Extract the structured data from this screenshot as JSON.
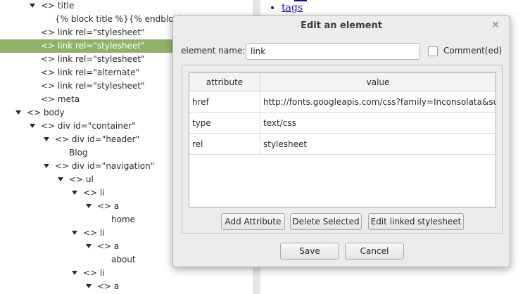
{
  "tree": {
    "rows": [
      {
        "text": "<> title",
        "arrow": true,
        "selected": false
      },
      {
        "text": "{% block title %}{% endblock %",
        "arrow": false,
        "selected": false
      },
      {
        "text": "<> link rel=\"stylesheet\"",
        "arrow": false,
        "selected": false
      },
      {
        "text": "<> link rel=\"stylesheet\"",
        "arrow": false,
        "selected": true
      },
      {
        "text": "<> link rel=\"stylesheet\"",
        "arrow": false,
        "selected": false
      },
      {
        "text": "<> link rel=\"alternate\"",
        "arrow": false,
        "selected": false
      },
      {
        "text": "<> link rel=\"stylesheet\"",
        "arrow": false,
        "selected": false
      },
      {
        "text": "<> meta",
        "arrow": false,
        "selected": false
      },
      {
        "text": "<> body",
        "arrow": true,
        "selected": false
      },
      {
        "text": "<> div id=\"container\"",
        "arrow": true,
        "selected": false
      },
      {
        "text": "<> div id=\"header\"",
        "arrow": true,
        "selected": false
      },
      {
        "text": "Blog",
        "arrow": false,
        "selected": false
      },
      {
        "text": "<> div id=\"navigation\"",
        "arrow": true,
        "selected": false
      },
      {
        "text": "<> ul",
        "arrow": true,
        "selected": false
      },
      {
        "text": "<> li",
        "arrow": true,
        "selected": false
      },
      {
        "text": "<> a",
        "arrow": true,
        "selected": false
      },
      {
        "text": "home",
        "arrow": false,
        "selected": false
      },
      {
        "text": "<> li",
        "arrow": true,
        "selected": false
      },
      {
        "text": "<> a",
        "arrow": true,
        "selected": false
      },
      {
        "text": "about",
        "arrow": false,
        "selected": false
      },
      {
        "text": "<> li",
        "arrow": true,
        "selected": false
      },
      {
        "text": "<> a",
        "arrow": true,
        "selected": false
      }
    ]
  },
  "preview": {
    "link_text": "tags",
    "link_color": "#1a0dab"
  },
  "dialog": {
    "title": "Edit an element",
    "close_icon": "close-icon",
    "element_name_label": "element name:",
    "element_name_value": "link",
    "comment_label": "Comment(ed)",
    "comment_checked": false,
    "table": {
      "headers": {
        "attribute": "attribute",
        "value": "value"
      },
      "rows": [
        {
          "attribute": "href",
          "value": "http://fonts.googleapis.com/css?family=Inconsolata&su..."
        },
        {
          "attribute": "type",
          "value": "text/css"
        },
        {
          "attribute": "rel",
          "value": "stylesheet"
        }
      ]
    },
    "buttons": {
      "add_attribute": "Add Attribute",
      "delete_selected": "Delete Selected",
      "edit_linked_stylesheet": "Edit linked stylesheet",
      "save": "Save",
      "cancel": "Cancel"
    }
  },
  "colors": {
    "selection": "#8fb16a",
    "dialog_bg": "#ececec"
  }
}
